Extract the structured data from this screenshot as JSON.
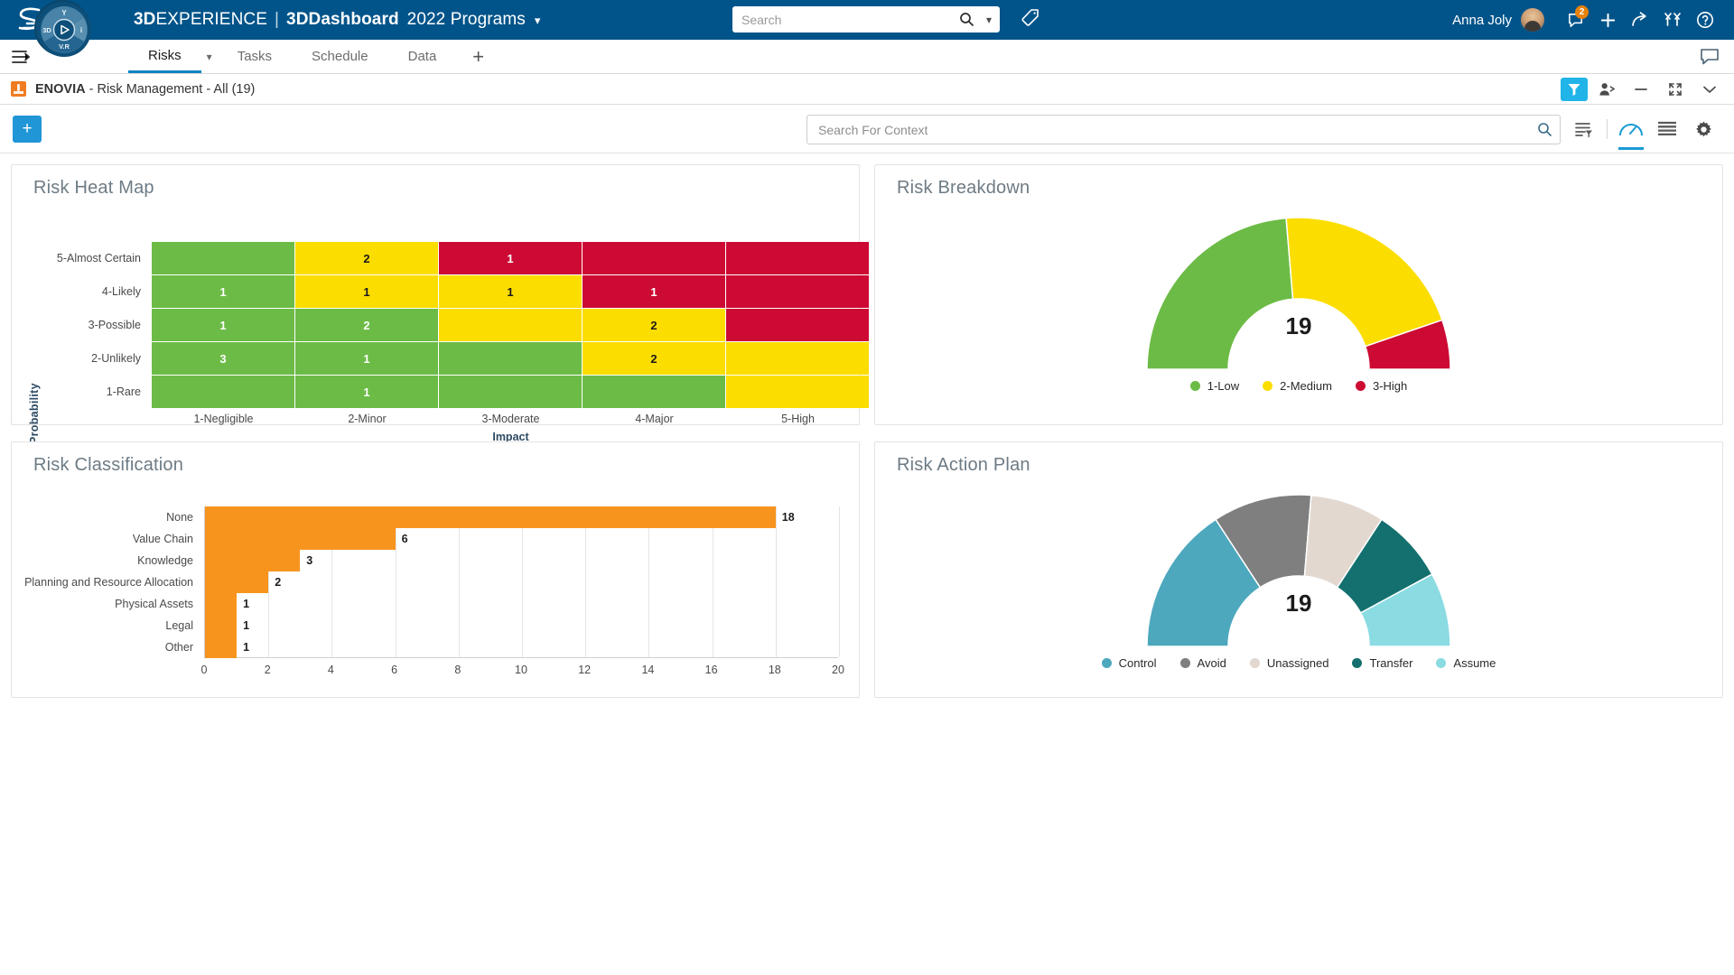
{
  "topbar": {
    "brand_1": "3D",
    "brand_2": "EXPERIENCE",
    "brand_sep": "|",
    "brand_3": "3DDashboard",
    "brand_4": "2022 Programs",
    "brand_caret": "chevron-down",
    "search_placeholder": "Search",
    "search_value": "",
    "username": "Anna Joly",
    "notification_count": "2"
  },
  "tabbar": {
    "tabs": [
      {
        "label": "Risks",
        "active": true
      },
      {
        "label": "Tasks",
        "active": false
      },
      {
        "label": "Schedule",
        "active": false
      },
      {
        "label": "Data",
        "active": false
      }
    ],
    "add_tab_label": "+"
  },
  "appheader": {
    "title_app": "ENOVIA",
    "title_rest": " - Risk Management - All (19)",
    "title_full": "ENOVIA - Risk Management - All (19)"
  },
  "subbar": {
    "add_label": "+",
    "context_search_placeholder": "Search For Context",
    "context_search_value": ""
  },
  "chart_data": [
    {
      "type": "heatmap",
      "title": "Risk Heat Map",
      "xlabel": "Impact",
      "ylabel": "Probability",
      "xticks": [
        "1-Negligible",
        "2-Minor",
        "3-Moderate",
        "4-Major",
        "5-High"
      ],
      "yticks": [
        "5-Almost Certain",
        "4-Likely",
        "3-Possible",
        "2-Unlikely",
        "1-Rare"
      ],
      "colors": {
        "green": "#6cb martyr",
        "g": "#63b council"
      },
      "rows": [
        {
          "label": "5-Almost Certain",
          "cells": [
            {
              "value": "",
              "color": "#6cbb46",
              "text": "#ffffff"
            },
            {
              "value": "2",
              "color": "#fcdd00",
              "text": "#1a1a1a"
            },
            {
              "value": "1",
              "color": "#cc0a33",
              "text": "#ffffff"
            },
            {
              "value": "",
              "color": "#cc0a33",
              "text": "#ffffff"
            },
            {
              "value": "",
              "color": "#cc0a33",
              "text": "#ffffff"
            }
          ]
        },
        {
          "label": "4-Likely",
          "cells": [
            {
              "value": "1",
              "color": "#6cbb46",
              "text": "#ffffff"
            },
            {
              "value": "1",
              "color": "#fcdd00",
              "text": "#1a1a1a"
            },
            {
              "value": "1",
              "color": "#fcdd00",
              "text": "#1a1a1a"
            },
            {
              "value": "1",
              "color": "#cc0a33",
              "text": "#ffffff"
            },
            {
              "value": "",
              "color": "#cc0a33",
              "text": "#ffffff"
            }
          ]
        },
        {
          "label": "3-Possible",
          "cells": [
            {
              "value": "1",
              "color": "#6cbb46",
              "text": "#ffffff"
            },
            {
              "value": "2",
              "color": "#6cbb46",
              "text": "#ffffff"
            },
            {
              "value": "",
              "color": "#fcdd00",
              "text": "#1a1a1a"
            },
            {
              "value": "2",
              "color": "#fcdd00",
              "text": "#1a1a1a"
            },
            {
              "value": "",
              "color": "#cc0a33",
              "text": "#ffffff"
            }
          ]
        },
        {
          "label": "2-Unlikely",
          "cells": [
            {
              "value": "3",
              "color": "#6cbb46",
              "text": "#ffffff"
            },
            {
              "value": "1",
              "color": "#6cbb46",
              "text": "#ffffff"
            },
            {
              "value": "",
              "color": "#6cbb46",
              "text": "#ffffff"
            },
            {
              "value": "2",
              "color": "#fcdd00",
              "text": "#1a1a1a"
            },
            {
              "value": "",
              "color": "#fcdd00",
              "text": "#1a1a1a"
            }
          ]
        },
        {
          "label": "1-Rare",
          "cells": [
            {
              "value": "",
              "color": "#6cbb46",
              "text": "#ffffff"
            },
            {
              "value": "1",
              "color": "#6cbb46",
              "text": "#ffffff"
            },
            {
              "value": "",
              "color": "#6cbb46",
              "text": "#ffffff"
            },
            {
              "value": "",
              "color": "#6cbb46",
              "text": "#ffffff"
            },
            {
              "value": "",
              "color": "#fcdd00",
              "text": "#1a1a1a"
            }
          ]
        }
      ]
    },
    {
      "type": "pie",
      "variant": "half-donut",
      "title": "Risk Breakdown",
      "center_value": "19",
      "total": 19,
      "legend_position": "bottom",
      "slices": [
        {
          "label": "1-Low",
          "value": 9,
          "color": "#6cbb46"
        },
        {
          "label": "2-Medium",
          "value": 8,
          "color": "#fcdd00"
        },
        {
          "label": "3-High",
          "value": 2,
          "color": "#cc0a33"
        }
      ]
    },
    {
      "type": "bar",
      "variant": "horizontal",
      "title": "Risk Classification",
      "xlabel": "",
      "ylabel": "",
      "xlim": [
        0,
        20
      ],
      "xticks": [
        0,
        2,
        4,
        6,
        8,
        10,
        12,
        14,
        16,
        18,
        20
      ],
      "bar_color": "#f7941e",
      "categories": [
        "None",
        "Value Chain",
        "Knowledge",
        "Planning and Resource Allocation",
        "Physical Assets",
        "Legal",
        "Other"
      ],
      "values": [
        18,
        6,
        3,
        2,
        1,
        1,
        1
      ]
    },
    {
      "type": "pie",
      "variant": "half-donut",
      "title": "Risk Action Plan",
      "center_value": "19",
      "total": 19,
      "legend_position": "bottom",
      "slices": [
        {
          "label": "Control",
          "value": 6,
          "color": "#4da8bd"
        },
        {
          "label": "Avoid",
          "value": 4,
          "color": "#7f7f7f"
        },
        {
          "label": "Unassigned",
          "value": 3,
          "color": "#e2d8d0"
        },
        {
          "label": "Transfer",
          "value": 3,
          "color": "#13706f"
        },
        {
          "label": "Assume",
          "value": 3,
          "color": "#8bdbe3"
        }
      ]
    }
  ]
}
